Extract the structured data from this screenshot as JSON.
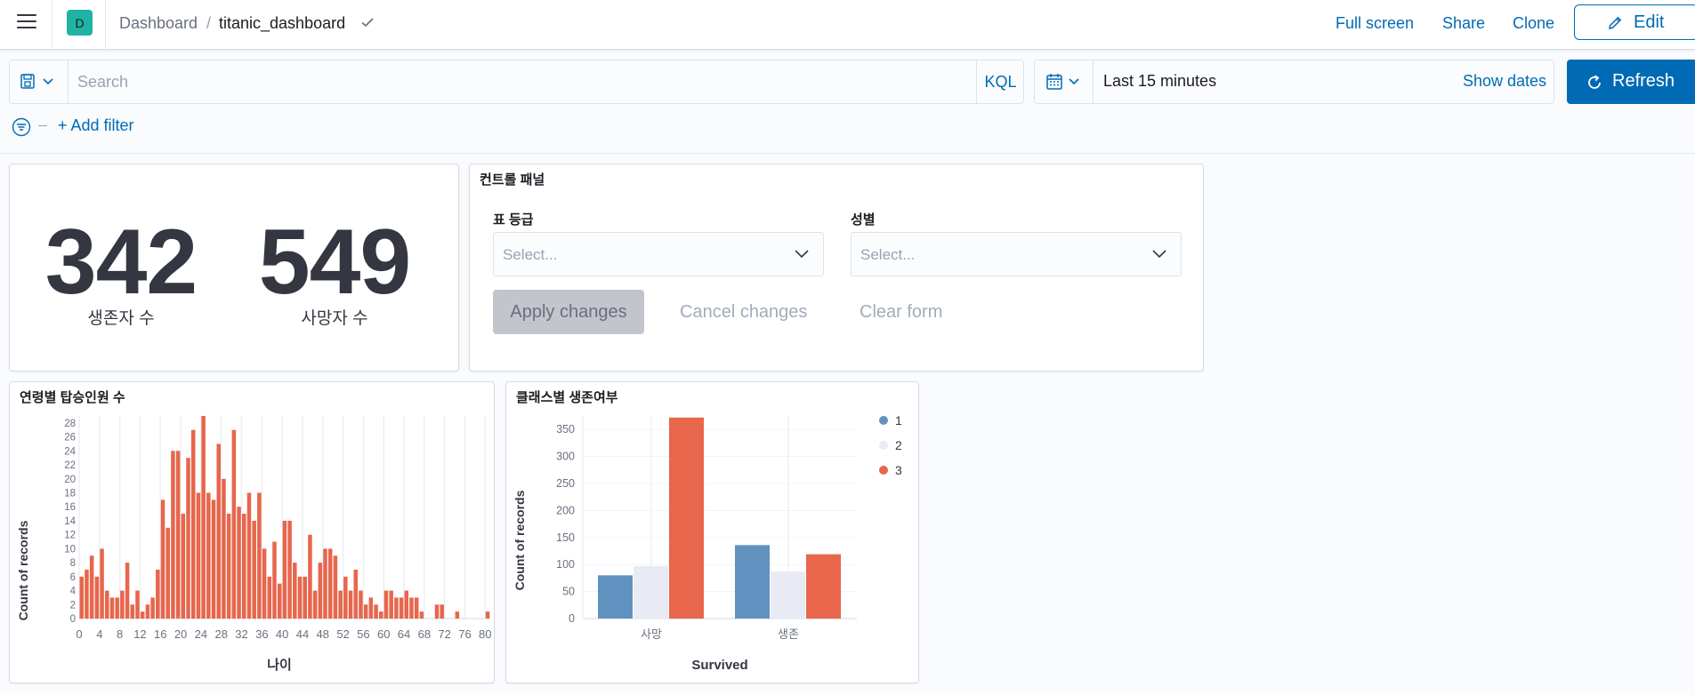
{
  "header": {
    "space_initial": "D",
    "breadcrumb_root": "Dashboard",
    "breadcrumb_separator": "/",
    "breadcrumb_current": "titanic_dashboard",
    "links": {
      "full_screen": "Full screen",
      "share": "Share",
      "clone": "Clone"
    },
    "edit_label": "Edit"
  },
  "query": {
    "search_placeholder": "Search",
    "language": "KQL",
    "time_range": "Last 15 minutes",
    "show_dates": "Show dates",
    "refresh_label": "Refresh",
    "add_filter": "+ Add filter"
  },
  "metrics_panel": {
    "metrics": [
      {
        "value": "342",
        "label": "생존자 수"
      },
      {
        "value": "549",
        "label": "사망자 수"
      }
    ]
  },
  "control_panel": {
    "title": "컨트롤 패널",
    "controls": [
      {
        "label": "표 등급",
        "placeholder": "Select..."
      },
      {
        "label": "성별",
        "placeholder": "Select..."
      }
    ],
    "apply": "Apply changes",
    "cancel": "Cancel changes",
    "clear": "Clear form"
  },
  "colors": {
    "accent": "#006bb4",
    "bar_red": "#e7664c",
    "bar_blue": "#6092c0",
    "bar_light": "#e8ebf3"
  },
  "chart_data": [
    {
      "type": "bar",
      "title": "연령별 탑승인원 수",
      "xlabel": "나이",
      "ylabel": "Count of records",
      "xlim": [
        0,
        81
      ],
      "ylim": [
        0,
        29
      ],
      "x_ticks": [
        0,
        4,
        8,
        12,
        16,
        20,
        24,
        28,
        32,
        36,
        40,
        44,
        48,
        52,
        56,
        60,
        64,
        68,
        72,
        76,
        80
      ],
      "y_ticks": [
        0,
        2,
        4,
        6,
        8,
        10,
        12,
        14,
        16,
        18,
        20,
        22,
        24,
        26,
        28
      ],
      "x": [
        0,
        1,
        2,
        3,
        4,
        5,
        6,
        7,
        8,
        9,
        10,
        11,
        12,
        13,
        14,
        15,
        16,
        17,
        18,
        19,
        20,
        21,
        22,
        23,
        24,
        25,
        26,
        27,
        28,
        29,
        30,
        31,
        32,
        33,
        34,
        35,
        36,
        37,
        38,
        39,
        40,
        41,
        42,
        43,
        44,
        45,
        46,
        47,
        48,
        49,
        50,
        51,
        52,
        53,
        54,
        55,
        56,
        57,
        58,
        59,
        60,
        61,
        62,
        63,
        64,
        65,
        66,
        67,
        70,
        71,
        74,
        80
      ],
      "values": [
        6,
        7,
        9,
        6,
        10,
        4,
        3,
        3,
        4,
        8,
        2,
        4,
        1,
        2,
        3,
        7,
        17,
        13,
        24,
        24,
        15,
        23,
        27,
        18,
        29,
        18,
        17,
        25,
        20,
        15,
        27,
        16,
        15,
        18,
        14,
        18,
        10,
        6,
        11,
        5,
        14,
        14,
        8,
        6,
        6,
        12,
        4,
        8,
        10,
        10,
        9,
        4,
        6,
        4,
        7,
        4,
        2,
        3,
        2,
        1,
        4,
        4,
        3,
        3,
        4,
        3,
        3,
        1,
        2,
        2,
        1,
        1
      ]
    },
    {
      "type": "bar",
      "title": "클래스별 생존여부",
      "xlabel": "Survived",
      "ylabel": "Count of records",
      "categories": [
        "사망",
        "생존"
      ],
      "ylim": [
        0,
        375
      ],
      "y_ticks": [
        0,
        50,
        100,
        150,
        200,
        250,
        300,
        350
      ],
      "legend_position": "top-right",
      "series": [
        {
          "name": "1",
          "color": "#6092c0",
          "values": [
            80,
            136
          ]
        },
        {
          "name": "2",
          "color": "#e8ebf3",
          "values": [
            97,
            87
          ]
        },
        {
          "name": "3",
          "color": "#e7664c",
          "values": [
            372,
            119
          ]
        }
      ]
    }
  ]
}
